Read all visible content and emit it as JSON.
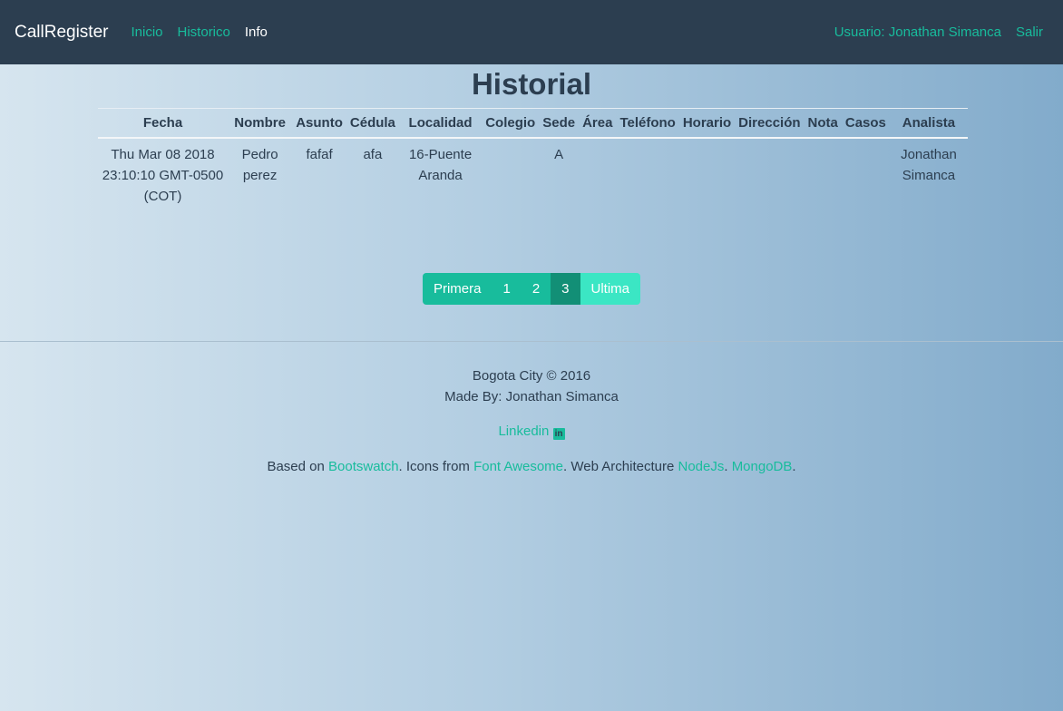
{
  "navbar": {
    "brand": "CallRegister",
    "links": [
      "Inicio",
      "Historico",
      "Info"
    ],
    "user": "Usuario: Jonathan Simanca",
    "logout": "Salir"
  },
  "page": {
    "title": "Historial"
  },
  "table": {
    "headers": [
      "Fecha",
      "Nombre",
      "Asunto",
      "Cédula",
      "Localidad",
      "Colegio",
      "Sede",
      "Área",
      "Teléfono",
      "Horario",
      "Dirección",
      "Nota",
      "Casos",
      "Analista"
    ],
    "rows": [
      [
        "Thu Mar 08 2018 23:10:10 GMT-0500 (COT)",
        "Pedro perez",
        "fafaf",
        "afa",
        "16-Puente Aranda",
        "",
        "A",
        "",
        "",
        "",
        "",
        "",
        "",
        "Jonathan Simanca"
      ]
    ]
  },
  "pagination": {
    "first": "Primera",
    "pages": [
      "1",
      "2",
      "3"
    ],
    "active": "3",
    "last": "Ultima"
  },
  "footer": {
    "line1": "Bogota City © 2016",
    "line2": "Made By: Jonathan Simanca",
    "linkedin": "Linkedin",
    "based_on_prefix": "Based on ",
    "bootswatch": "Bootswatch",
    "icons_from": ". Icons from ",
    "font_awesome": "Font Awesome",
    "web_arch": ". Web Architecture ",
    "nodejs": "NodeJs",
    "sep": ". ",
    "mongodb": "MongoDB",
    "end": "."
  }
}
